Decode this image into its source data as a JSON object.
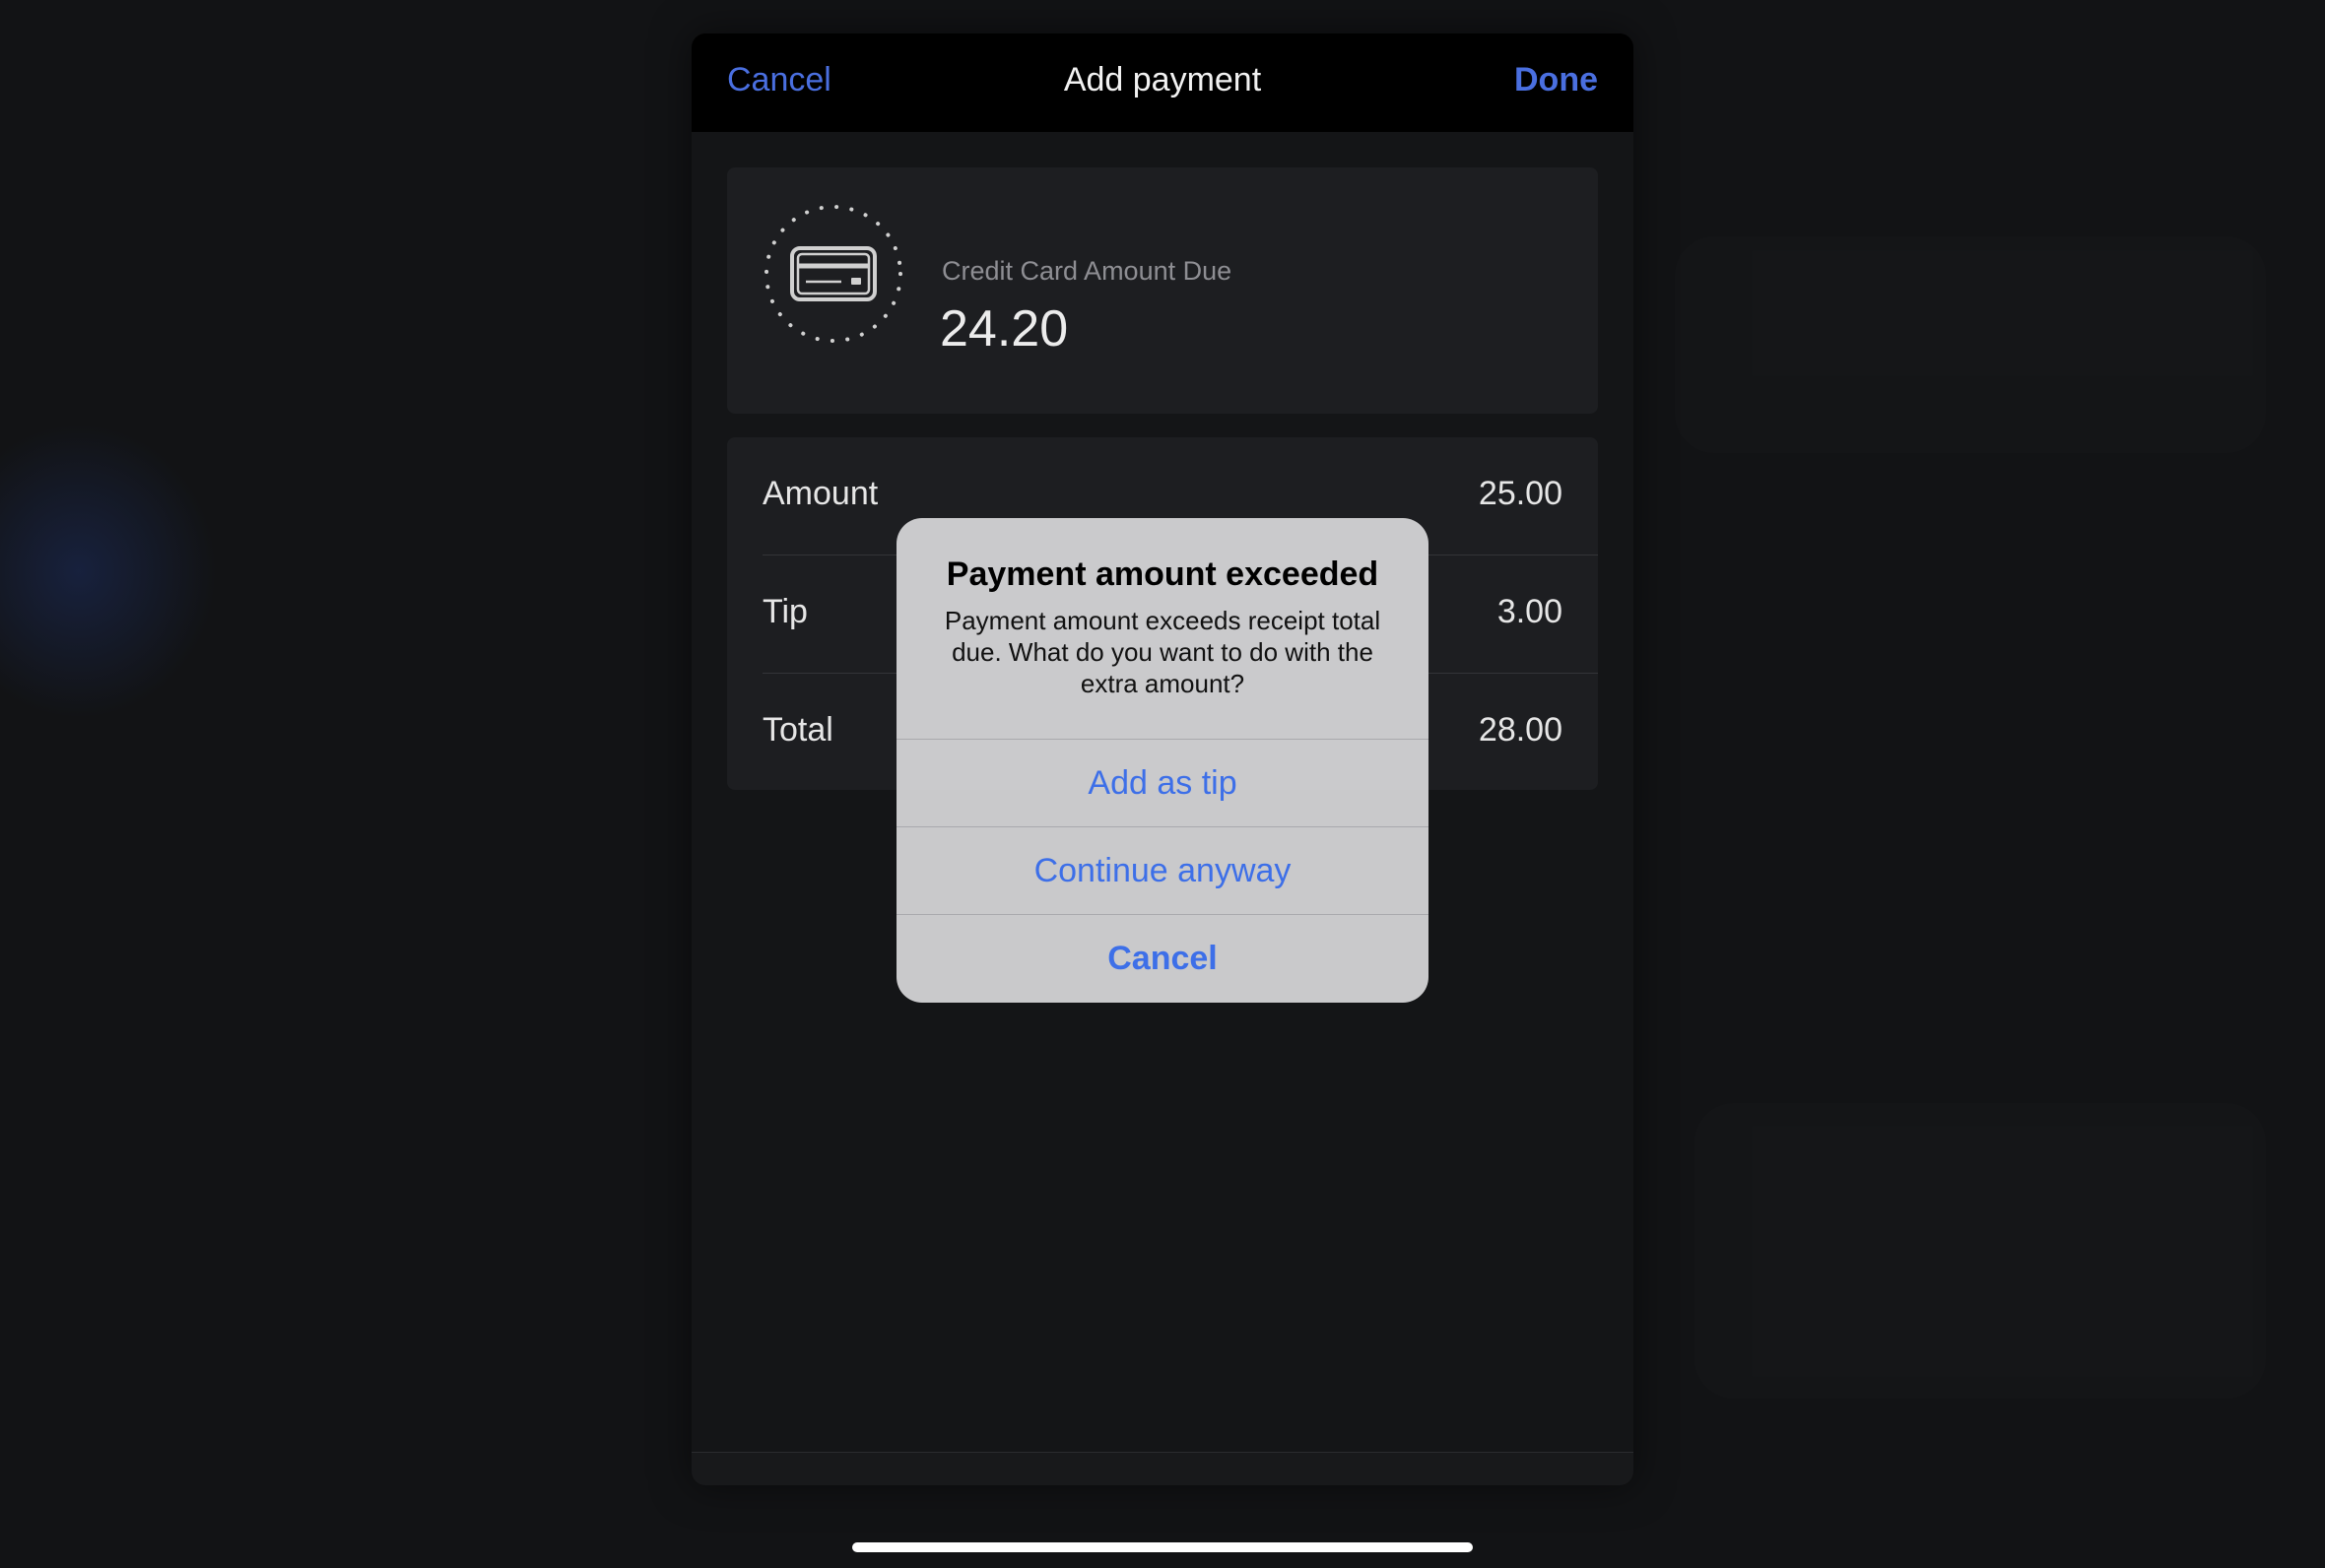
{
  "navbar": {
    "cancel_label": "Cancel",
    "title": "Add payment",
    "done_label": "Done"
  },
  "due": {
    "label": "Credit Card Amount Due",
    "value": "24.20",
    "icon": "credit-card-icon"
  },
  "rows": [
    {
      "label": "Amount",
      "value": "25.00"
    },
    {
      "label": "Tip",
      "value": "3.00"
    },
    {
      "label": "Total",
      "value": "28.00"
    }
  ],
  "alert": {
    "title": "Payment amount exceeded",
    "message": "Payment amount exceeds receipt total due. What do you want to do with the extra amount?",
    "buttons": [
      {
        "label": "Add as tip"
      },
      {
        "label": "Continue anyway"
      },
      {
        "label": "Cancel"
      }
    ]
  },
  "colors": {
    "accent": "#4a6fe0",
    "alert_accent": "#3d6fe8",
    "background": "#121315",
    "sheet": "#141517",
    "card": "#1d1e21"
  }
}
